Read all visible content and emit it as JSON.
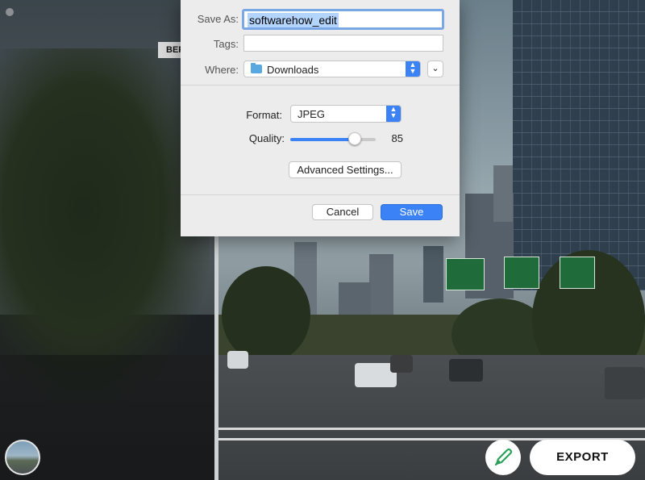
{
  "window": {
    "before_label": "BEFORE"
  },
  "dialog": {
    "save_as_label": "Save As:",
    "save_as_value": "softwarehow_edit",
    "tags_label": "Tags:",
    "tags_value": "",
    "where_label": "Where:",
    "where_value": "Downloads",
    "where_icon": "folder-icon",
    "format_label": "Format:",
    "format_value": "JPEG",
    "quality_label": "Quality:",
    "quality_value": "85",
    "quality_fraction": 0.75,
    "advanced_label": "Advanced Settings...",
    "cancel_label": "Cancel",
    "save_label": "Save"
  },
  "toolbar": {
    "export_label": "EXPORT",
    "pen_icon": "pen-icon",
    "pen_color": "#2aa05a"
  },
  "colors": {
    "accent": "#3b82f6",
    "selection": "#b3d4fd"
  }
}
